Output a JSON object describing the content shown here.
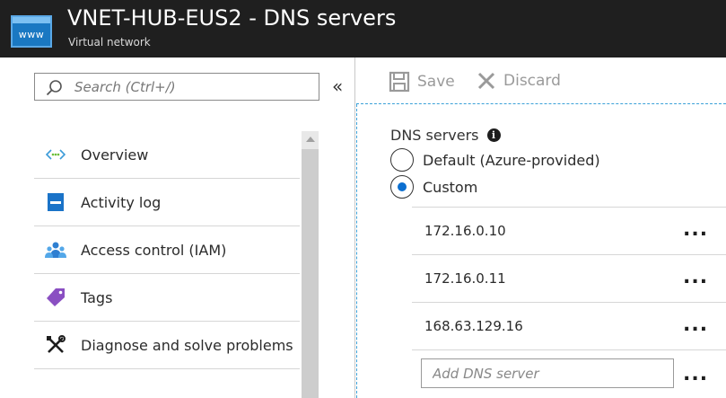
{
  "header": {
    "title": "VNET-HUB-EUS2 - DNS servers",
    "subtitle": "Virtual network",
    "app_icon": {
      "name": "virtual-network-icon",
      "text": "www",
      "color": "#1a78c2"
    }
  },
  "sidebar": {
    "search": {
      "placeholder": "Search (Ctrl+/)",
      "value": ""
    },
    "collapse_glyph": "«",
    "items": [
      {
        "label": "Overview",
        "icon": "overview-icon"
      },
      {
        "label": "Activity log",
        "icon": "activity-log-icon"
      },
      {
        "label": "Access control (IAM)",
        "icon": "access-control-icon"
      },
      {
        "label": "Tags",
        "icon": "tag-icon"
      },
      {
        "label": "Diagnose and solve problems",
        "icon": "wrench-icon"
      }
    ]
  },
  "toolbar": {
    "save_label": "Save",
    "discard_label": "Discard"
  },
  "dns": {
    "label": "DNS servers",
    "options": [
      {
        "label": "Default (Azure-provided)",
        "selected": false
      },
      {
        "label": "Custom",
        "selected": true
      }
    ],
    "servers": [
      "172.16.0.10",
      "172.16.0.11",
      "168.63.129.16"
    ],
    "add_placeholder": "Add DNS server",
    "more_glyph": "..."
  },
  "colors": {
    "header_bg": "#1f1f1f",
    "accent": "#0b6fd0",
    "focus_border": "#3aa0d8"
  }
}
